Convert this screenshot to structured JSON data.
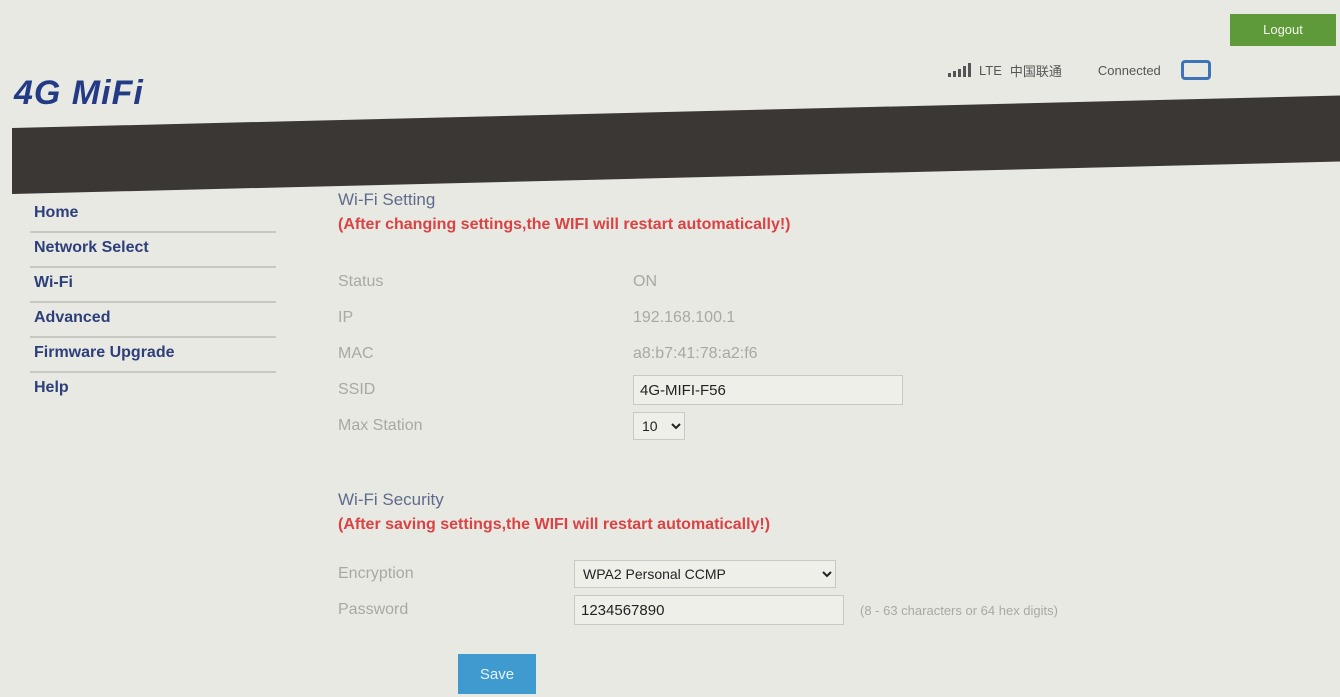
{
  "header": {
    "logo": "4G MiFi",
    "logout_label": "Logout",
    "network_type": "LTE",
    "carrier": "中国联通",
    "connection_status": "Connected"
  },
  "sidebar": {
    "items": [
      {
        "label": "Home"
      },
      {
        "label": "Network Select"
      },
      {
        "label": "Wi-Fi"
      },
      {
        "label": "Advanced"
      },
      {
        "label": "Firmware Upgrade"
      },
      {
        "label": "Help"
      }
    ]
  },
  "wifi_setting": {
    "title": "Wi-Fi Setting",
    "warning": "(After changing settings,the WIFI will restart automatically!)",
    "status_label": "Status",
    "status_value": "ON",
    "ip_label": "IP",
    "ip_value": "192.168.100.1",
    "mac_label": "MAC",
    "mac_value": "a8:b7:41:78:a2:f6",
    "ssid_label": "SSID",
    "ssid_value": "4G-MIFI-F56",
    "max_station_label": "Max Station",
    "max_station_value": "10"
  },
  "wifi_security": {
    "title": "Wi-Fi Security",
    "warning": "(After saving settings,the WIFI will restart automatically!)",
    "encryption_label": "Encryption",
    "encryption_value": "WPA2 Personal CCMP",
    "password_label": "Password",
    "password_value": "1234567890",
    "password_hint": "(8 - 63 characters or 64 hex digits)"
  },
  "save_label": "Save"
}
